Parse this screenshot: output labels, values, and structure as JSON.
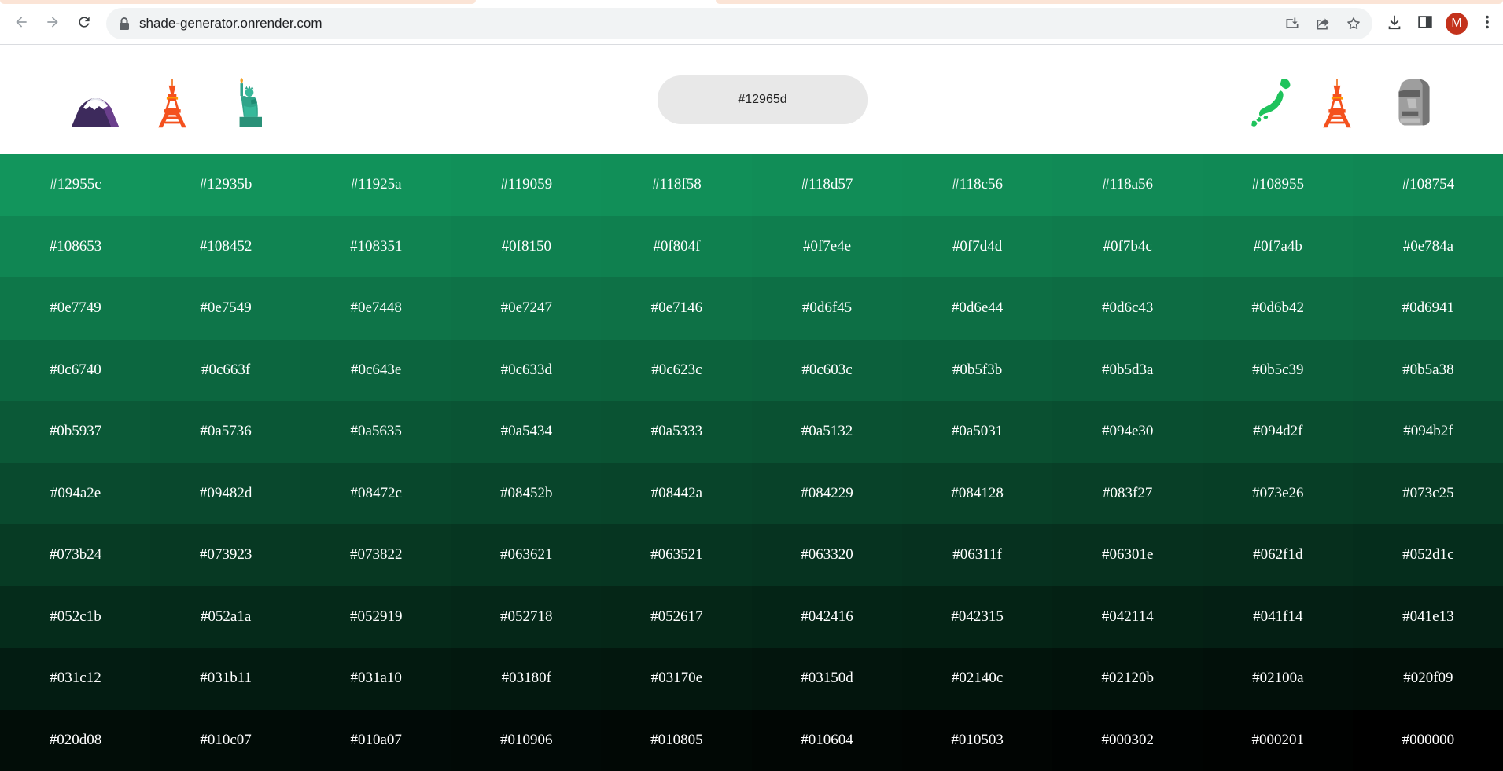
{
  "browser": {
    "url": "shade-generator.onrender.com",
    "profile_initial": "M",
    "icons": {
      "back": "back-arrow-icon",
      "forward": "forward-arrow-icon",
      "reload": "reload-icon",
      "lock": "lock-icon",
      "install": "install-app-icon",
      "share": "share-icon",
      "bookmark": "star-icon",
      "downloads": "download-icon",
      "side_panel": "side-panel-icon",
      "menu": "kebab-menu-icon"
    }
  },
  "header": {
    "hex_input_value": "#12965d",
    "left_decorations": [
      "mount-fuji-emoji",
      "tokyo-tower-emoji",
      "statue-of-liberty-emoji"
    ],
    "right_decorations": [
      "japan-map-emoji",
      "tokyo-tower-emoji",
      "moai-emoji"
    ]
  },
  "shades": [
    [
      "#12955c",
      "#12935b",
      "#11925a",
      "#119059",
      "#118f58",
      "#118d57",
      "#118c56",
      "#118a56",
      "#108955",
      "#108754"
    ],
    [
      "#108653",
      "#108452",
      "#108351",
      "#0f8150",
      "#0f804f",
      "#0f7e4e",
      "#0f7d4d",
      "#0f7b4c",
      "#0f7a4b",
      "#0e784a"
    ],
    [
      "#0e7749",
      "#0e7549",
      "#0e7448",
      "#0e7247",
      "#0e7146",
      "#0d6f45",
      "#0d6e44",
      "#0d6c43",
      "#0d6b42",
      "#0d6941"
    ],
    [
      "#0c6740",
      "#0c663f",
      "#0c643e",
      "#0c633d",
      "#0c623c",
      "#0c603c",
      "#0b5f3b",
      "#0b5d3a",
      "#0b5c39",
      "#0b5a38"
    ],
    [
      "#0b5937",
      "#0a5736",
      "#0a5635",
      "#0a5434",
      "#0a5333",
      "#0a5132",
      "#0a5031",
      "#094e30",
      "#094d2f",
      "#094b2f"
    ],
    [
      "#094a2e",
      "#09482d",
      "#08472c",
      "#08452b",
      "#08442a",
      "#084229",
      "#084128",
      "#083f27",
      "#073e26",
      "#073c25"
    ],
    [
      "#073b24",
      "#073923",
      "#073822",
      "#063621",
      "#063521",
      "#063320",
      "#06311f",
      "#06301e",
      "#062f1d",
      "#052d1c"
    ],
    [
      "#052c1b",
      "#052a1a",
      "#052919",
      "#052718",
      "#052617",
      "#042416",
      "#042315",
      "#042114",
      "#041f14",
      "#041e13"
    ],
    [
      "#031c12",
      "#031b11",
      "#031a10",
      "#03180f",
      "#03170e",
      "#03150d",
      "#02140c",
      "#02120b",
      "#02100a",
      "#020f09"
    ],
    [
      "#020d08",
      "#010c07",
      "#010a07",
      "#010906",
      "#010805",
      "#010604",
      "#010503",
      "#000302",
      "#000201",
      "#000000"
    ]
  ]
}
